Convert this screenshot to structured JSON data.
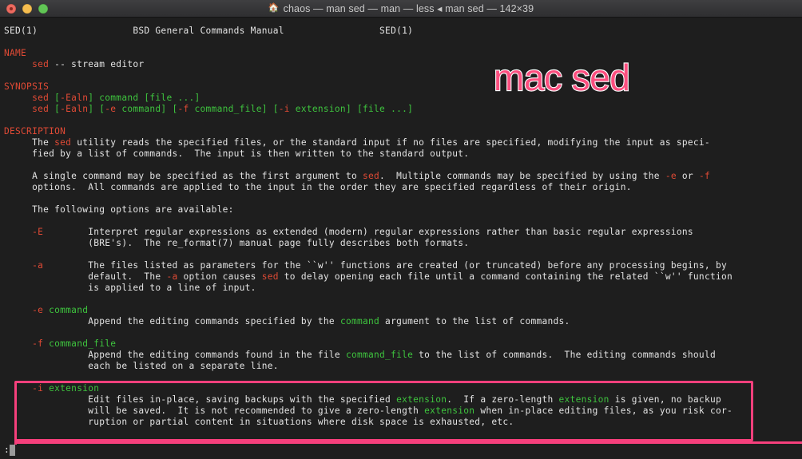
{
  "window": {
    "title": "chaos — man sed — man — less ◂ man sed — 142×39",
    "house_icon": "🏠",
    "traffic_lights": [
      {
        "name": "close",
        "color": "#ec6a5f"
      },
      {
        "name": "minimize",
        "color": "#f5bd4f"
      },
      {
        "name": "maximize",
        "color": "#61c555"
      }
    ]
  },
  "annotations": {
    "label": "mac sed",
    "label_color": "#fb4f7f",
    "label_stroke": "#ffffff",
    "box_color": "#f6407c"
  },
  "statusbar": {
    "prompt": ":"
  },
  "terminal": {
    "background": "#1e1e1e",
    "foreground": "#e3e3e3",
    "accent_red": "#e04a35",
    "accent_green": "#3ec43e",
    "lines": [
      {
        "segments": [
          {
            "t": "SED(1)                 BSD General Commands Manual                 SED(1)",
            "c": "white"
          }
        ]
      },
      {
        "segments": [
          {
            "t": "",
            "c": "white"
          }
        ]
      },
      {
        "segments": [
          {
            "t": "NAME",
            "c": "red"
          }
        ]
      },
      {
        "segments": [
          {
            "t": "     ",
            "c": "white"
          },
          {
            "t": "sed",
            "c": "red"
          },
          {
            "t": " -- stream editor",
            "c": "white"
          }
        ]
      },
      {
        "segments": [
          {
            "t": "",
            "c": "white"
          }
        ]
      },
      {
        "segments": [
          {
            "t": "SYNOPSIS",
            "c": "red"
          }
        ]
      },
      {
        "segments": [
          {
            "t": "     ",
            "c": "white"
          },
          {
            "t": "sed",
            "c": "red"
          },
          {
            "t": " ",
            "c": "white"
          },
          {
            "t": "[",
            "c": "green"
          },
          {
            "t": "-Ealn",
            "c": "red"
          },
          {
            "t": "] command [file ...]",
            "c": "green"
          }
        ]
      },
      {
        "segments": [
          {
            "t": "     ",
            "c": "white"
          },
          {
            "t": "sed",
            "c": "red"
          },
          {
            "t": " ",
            "c": "white"
          },
          {
            "t": "[",
            "c": "green"
          },
          {
            "t": "-Ealn",
            "c": "red"
          },
          {
            "t": "] [",
            "c": "green"
          },
          {
            "t": "-e",
            "c": "red"
          },
          {
            "t": " command] [",
            "c": "green"
          },
          {
            "t": "-f",
            "c": "red"
          },
          {
            "t": " command_file] [",
            "c": "green"
          },
          {
            "t": "-i",
            "c": "red"
          },
          {
            "t": " extension] [file ...]",
            "c": "green"
          }
        ]
      },
      {
        "segments": [
          {
            "t": "",
            "c": "white"
          }
        ]
      },
      {
        "segments": [
          {
            "t": "DESCRIPTION",
            "c": "red"
          }
        ]
      },
      {
        "segments": [
          {
            "t": "     The ",
            "c": "white"
          },
          {
            "t": "sed",
            "c": "red"
          },
          {
            "t": " utility reads the specified files, or the standard input if no files are specified, modifying the input as speci-",
            "c": "white"
          }
        ]
      },
      {
        "segments": [
          {
            "t": "     fied by a list of commands.  The input is then written to the standard output.",
            "c": "white"
          }
        ]
      },
      {
        "segments": [
          {
            "t": "",
            "c": "white"
          }
        ]
      },
      {
        "segments": [
          {
            "t": "     A single command may be specified as the first argument to ",
            "c": "white"
          },
          {
            "t": "sed",
            "c": "red"
          },
          {
            "t": ".  Multiple commands may be specified by using the ",
            "c": "white"
          },
          {
            "t": "-e",
            "c": "red"
          },
          {
            "t": " or ",
            "c": "white"
          },
          {
            "t": "-f",
            "c": "red"
          }
        ]
      },
      {
        "segments": [
          {
            "t": "     options.  All commands are applied to the input in the order they are specified regardless of their origin.",
            "c": "white"
          }
        ]
      },
      {
        "segments": [
          {
            "t": "",
            "c": "white"
          }
        ]
      },
      {
        "segments": [
          {
            "t": "     The following options are available:",
            "c": "white"
          }
        ]
      },
      {
        "segments": [
          {
            "t": "",
            "c": "white"
          }
        ]
      },
      {
        "segments": [
          {
            "t": "     ",
            "c": "white"
          },
          {
            "t": "-E",
            "c": "red"
          },
          {
            "t": "        Interpret regular expressions as extended (modern) regular expressions rather than basic regular expressions",
            "c": "white"
          }
        ]
      },
      {
        "segments": [
          {
            "t": "               (BRE's).  The re_format(7) manual page fully describes both formats.",
            "c": "white"
          }
        ]
      },
      {
        "segments": [
          {
            "t": "",
            "c": "white"
          }
        ]
      },
      {
        "segments": [
          {
            "t": "     ",
            "c": "white"
          },
          {
            "t": "-a",
            "c": "red"
          },
          {
            "t": "        The files listed as parameters for the ``w'' functions are created (or truncated) before any processing begins, by",
            "c": "white"
          }
        ]
      },
      {
        "segments": [
          {
            "t": "               default.  The ",
            "c": "white"
          },
          {
            "t": "-a",
            "c": "red"
          },
          {
            "t": " option causes ",
            "c": "white"
          },
          {
            "t": "sed",
            "c": "red"
          },
          {
            "t": " to delay opening each file until a command containing the related ``w'' function",
            "c": "white"
          }
        ]
      },
      {
        "segments": [
          {
            "t": "               is applied to a line of input.",
            "c": "white"
          }
        ]
      },
      {
        "segments": [
          {
            "t": "",
            "c": "white"
          }
        ]
      },
      {
        "segments": [
          {
            "t": "     ",
            "c": "white"
          },
          {
            "t": "-e",
            "c": "red"
          },
          {
            "t": " ",
            "c": "white"
          },
          {
            "t": "command",
            "c": "green"
          }
        ]
      },
      {
        "segments": [
          {
            "t": "               Append the editing commands specified by the ",
            "c": "white"
          },
          {
            "t": "command",
            "c": "green"
          },
          {
            "t": " argument to the list of commands.",
            "c": "white"
          }
        ]
      },
      {
        "segments": [
          {
            "t": "",
            "c": "white"
          }
        ]
      },
      {
        "segments": [
          {
            "t": "     ",
            "c": "white"
          },
          {
            "t": "-f",
            "c": "red"
          },
          {
            "t": " ",
            "c": "white"
          },
          {
            "t": "command_file",
            "c": "green"
          }
        ]
      },
      {
        "segments": [
          {
            "t": "               Append the editing commands found in the file ",
            "c": "white"
          },
          {
            "t": "command_file",
            "c": "green"
          },
          {
            "t": " to the list of commands.  The editing commands should",
            "c": "white"
          }
        ]
      },
      {
        "segments": [
          {
            "t": "               each be listed on a separate line.",
            "c": "white"
          }
        ]
      },
      {
        "segments": [
          {
            "t": "",
            "c": "white"
          }
        ]
      },
      {
        "segments": [
          {
            "t": "     ",
            "c": "white"
          },
          {
            "t": "-i",
            "c": "red"
          },
          {
            "t": " ",
            "c": "white"
          },
          {
            "t": "extension",
            "c": "green"
          }
        ]
      },
      {
        "segments": [
          {
            "t": "               Edit files in-place, saving backups with the specified ",
            "c": "white"
          },
          {
            "t": "extension",
            "c": "green"
          },
          {
            "t": ".  If a zero-length ",
            "c": "white"
          },
          {
            "t": "extension",
            "c": "green"
          },
          {
            "t": " is given, no backup",
            "c": "white"
          }
        ]
      },
      {
        "segments": [
          {
            "t": "               will be saved.  It is not recommended to give a zero-length ",
            "c": "white"
          },
          {
            "t": "extension",
            "c": "green"
          },
          {
            "t": " when in-place editing files, as you risk cor-",
            "c": "white"
          }
        ]
      },
      {
        "segments": [
          {
            "t": "               ruption or partial content in situations where disk space is exhausted, etc.",
            "c": "white"
          }
        ]
      }
    ]
  }
}
